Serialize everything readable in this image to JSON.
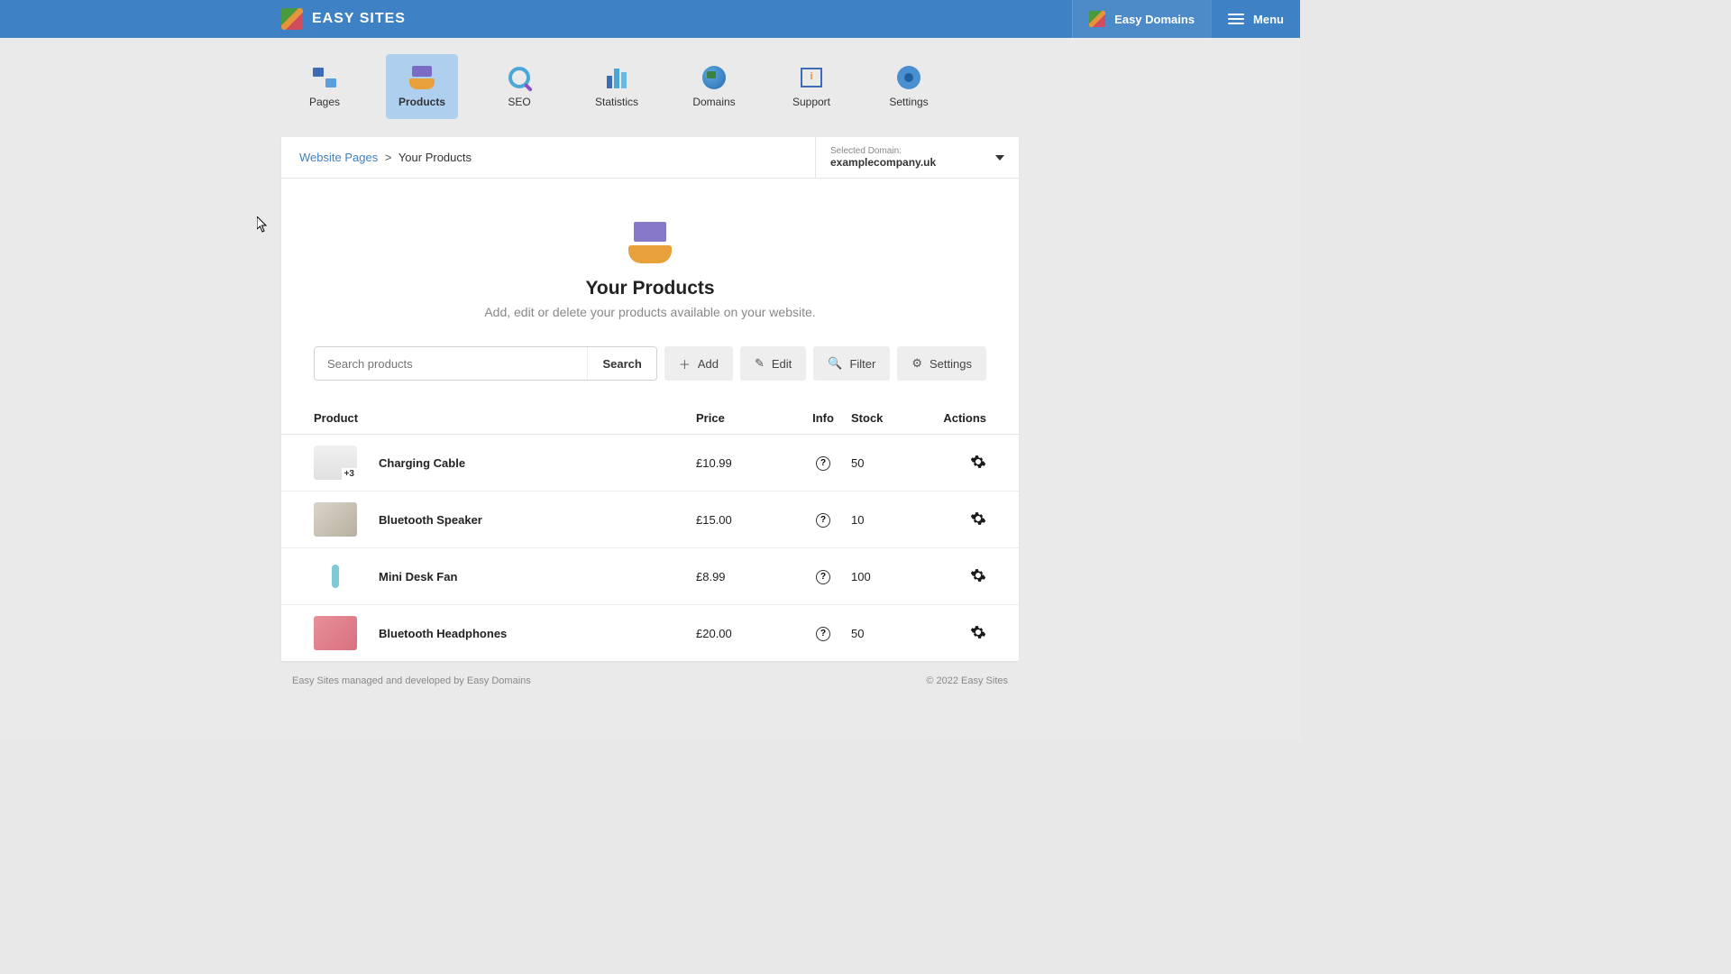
{
  "brand": "EASY SITES",
  "topbar": {
    "domains_label": "Easy Domains",
    "menu_label": "Menu"
  },
  "nav": [
    {
      "label": "Pages",
      "active": false,
      "icon": "pages"
    },
    {
      "label": "Products",
      "active": true,
      "icon": "products"
    },
    {
      "label": "SEO",
      "active": false,
      "icon": "seo"
    },
    {
      "label": "Statistics",
      "active": false,
      "icon": "stats"
    },
    {
      "label": "Domains",
      "active": false,
      "icon": "domains"
    },
    {
      "label": "Support",
      "active": false,
      "icon": "support"
    },
    {
      "label": "Settings",
      "active": false,
      "icon": "settings"
    }
  ],
  "breadcrumb": {
    "root": "Website Pages",
    "sep": ">",
    "current": "Your Products"
  },
  "domain_select": {
    "label": "Selected Domain:",
    "value": "examplecompany.uk"
  },
  "hero": {
    "title": "Your Products",
    "subtitle": "Add, edit or delete your products available on your website."
  },
  "search": {
    "placeholder": "Search products",
    "button": "Search"
  },
  "toolbar": {
    "add": "Add",
    "edit": "Edit",
    "filter": "Filter",
    "settings": "Settings"
  },
  "columns": {
    "product": "Product",
    "price": "Price",
    "info": "Info",
    "stock": "Stock",
    "actions": "Actions"
  },
  "rows": [
    {
      "name": "Charging Cable",
      "price": "£10.99",
      "stock": "50",
      "badge": "+3",
      "thumb": "t1"
    },
    {
      "name": "Bluetooth Speaker",
      "price": "£15.00",
      "stock": "10",
      "badge": "",
      "thumb": "t2"
    },
    {
      "name": "Mini Desk Fan",
      "price": "£8.99",
      "stock": "100",
      "badge": "",
      "thumb": "t3"
    },
    {
      "name": "Bluetooth Headphones",
      "price": "£20.00",
      "stock": "50",
      "badge": "",
      "thumb": "t4"
    }
  ],
  "footer": {
    "left": "Easy Sites managed and developed by Easy Domains",
    "right": "© 2022 Easy Sites"
  }
}
